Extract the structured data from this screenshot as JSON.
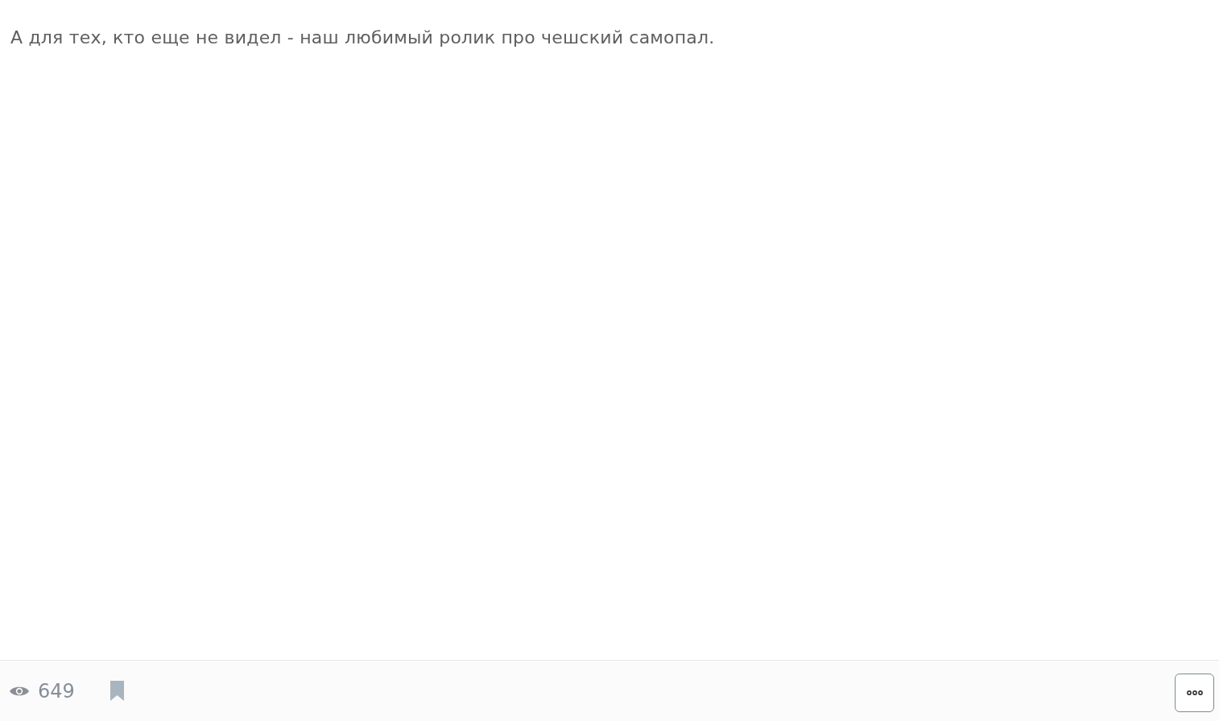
{
  "post": {
    "text": "А для тех, кто еще не видел - наш любимый ролик про чешский самопал."
  },
  "footer": {
    "views": "649",
    "bookmarked": false
  }
}
